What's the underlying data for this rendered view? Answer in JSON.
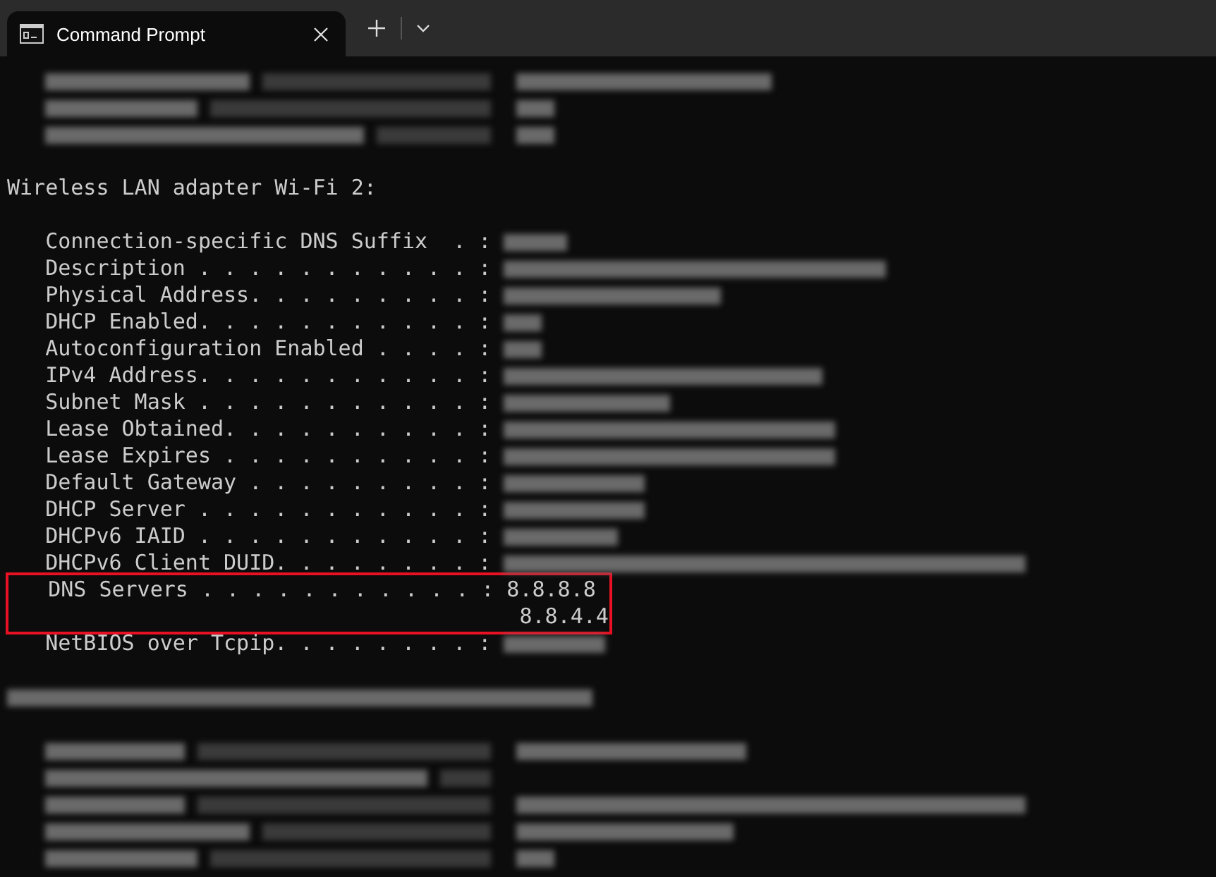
{
  "tabs": [
    {
      "title": "Command Prompt",
      "selected": true
    }
  ],
  "lines": [
    {
      "kind": "hidden"
    },
    {
      "kind": "hidden"
    },
    {
      "kind": "hidden"
    },
    {
      "kind": "blank"
    },
    {
      "kind": "heading",
      "text": "Wireless LAN adapter Wi-Fi 2:"
    },
    {
      "kind": "blank"
    },
    {
      "kind": "field",
      "label": "Connection-specific DNS Suffix  . :",
      "hidden": true,
      "highlighted": false
    },
    {
      "kind": "field",
      "label": "Description . . . . . . . . . . . :",
      "hidden": true,
      "highlighted": false
    },
    {
      "kind": "field",
      "label": "Physical Address. . . . . . . . . :",
      "hidden": true,
      "highlighted": false
    },
    {
      "kind": "field",
      "label": "DHCP Enabled. . . . . . . . . . . :",
      "hidden": true,
      "highlighted": false
    },
    {
      "kind": "field",
      "label": "Autoconfiguration Enabled . . . . :",
      "hidden": true,
      "highlighted": false
    },
    {
      "kind": "field",
      "label": "IPv4 Address. . . . . . . . . . . :",
      "hidden": true,
      "highlighted": false
    },
    {
      "kind": "field",
      "label": "Subnet Mask . . . . . . . . . . . :",
      "hidden": true,
      "highlighted": false
    },
    {
      "kind": "field",
      "label": "Lease Obtained. . . . . . . . . . :",
      "hidden": true,
      "highlighted": false
    },
    {
      "kind": "field",
      "label": "Lease Expires . . . . . . . . . . :",
      "hidden": true,
      "highlighted": false
    },
    {
      "kind": "field",
      "label": "Default Gateway . . . . . . . . . :",
      "hidden": true,
      "highlighted": false
    },
    {
      "kind": "field",
      "label": "DHCP Server . . . . . . . . . . . :",
      "hidden": true,
      "highlighted": false
    },
    {
      "kind": "field",
      "label": "DHCPv6 IAID . . . . . . . . . . . :",
      "hidden": true,
      "highlighted": false
    },
    {
      "kind": "field",
      "label": "DHCPv6 Client DUID. . . . . . . . :",
      "hidden": true,
      "highlighted": false
    },
    {
      "kind": "field",
      "label": "DNS Servers . . . . . . . . . . . :",
      "hidden": false,
      "highlighted": true,
      "values": [
        "8.8.8.8",
        "8.8.4.4"
      ]
    },
    {
      "kind": "field",
      "label": "NetBIOS over Tcpip. . . . . . . . :",
      "hidden": true,
      "highlighted": false
    },
    {
      "kind": "blank"
    },
    {
      "kind": "hidden_heading"
    },
    {
      "kind": "blank"
    },
    {
      "kind": "hidden"
    },
    {
      "kind": "hidden"
    },
    {
      "kind": "hidden"
    },
    {
      "kind": "hidden"
    },
    {
      "kind": "hidden"
    }
  ]
}
